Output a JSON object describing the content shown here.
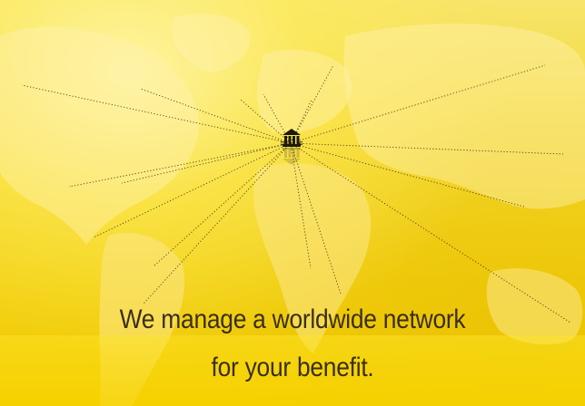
{
  "banner": {
    "tagline_line1": "We manage a worldwide network",
    "tagline_line2": "for your benefit."
  },
  "icons": {
    "hub": "bank-building-icon"
  },
  "colors": {
    "background": "#f4d730",
    "text": "#3a2f14",
    "rays": "#2b2410"
  }
}
